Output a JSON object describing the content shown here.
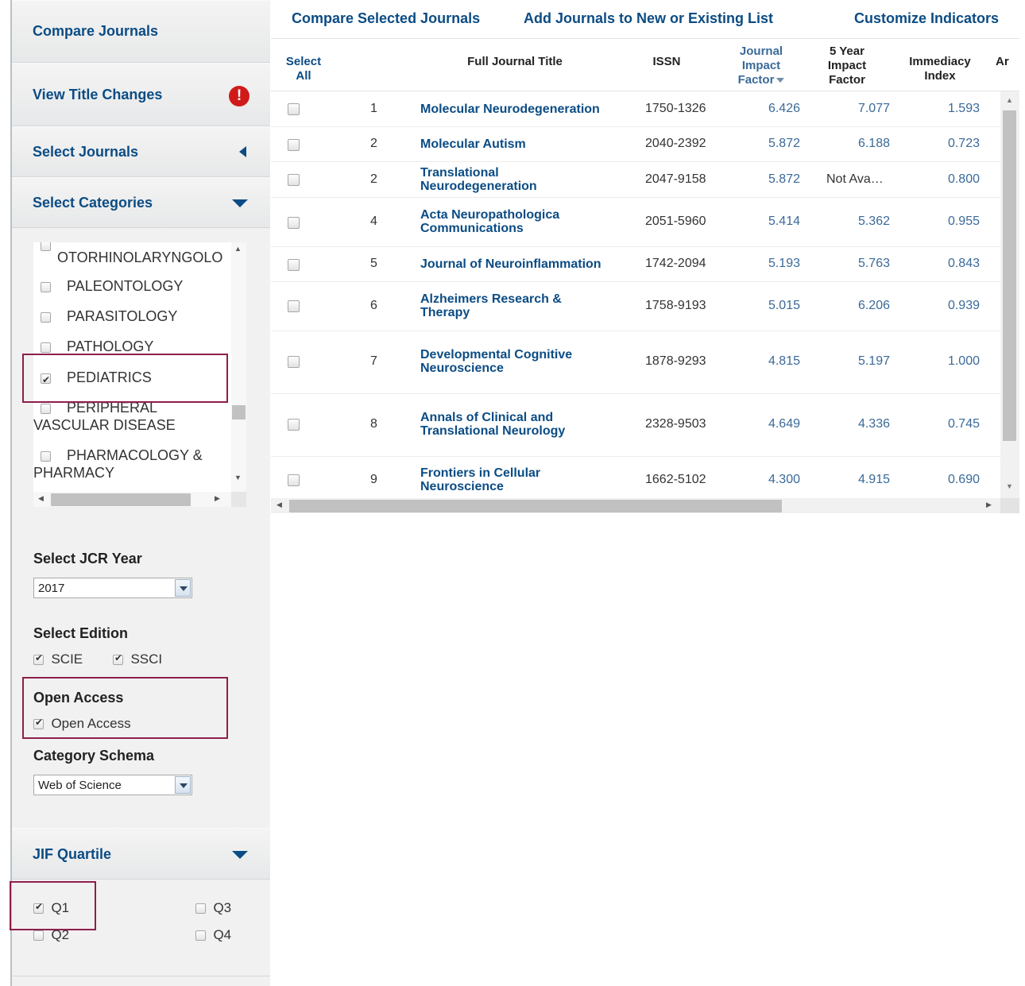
{
  "sidebar": {
    "compare_journals": "Compare Journals",
    "view_title_changes": "View Title Changes",
    "alert_glyph": "!",
    "select_journals": "Select Journals",
    "select_categories": "Select Categories",
    "categories": [
      {
        "label": "OTORHINOLARYNGOLO",
        "checked": false
      },
      {
        "label": "PALEONTOLOGY",
        "checked": false
      },
      {
        "label": "PARASITOLOGY",
        "checked": false
      },
      {
        "label": "PATHOLOGY",
        "checked": false
      },
      {
        "label": "PEDIATRICS",
        "checked": true
      },
      {
        "label": "PERIPHERAL",
        "label2": "VASCULAR DISEASE",
        "checked": false
      },
      {
        "label": "PHARMACOLOGY &",
        "label2": "PHARMACY",
        "checked": false
      }
    ],
    "jcr_year_title": "Select JCR Year",
    "jcr_year_value": "2017",
    "edition_title": "Select Edition",
    "editions": [
      {
        "label": "SCIE",
        "checked": true
      },
      {
        "label": "SSCI",
        "checked": true
      }
    ],
    "open_access_title": "Open Access",
    "open_access_label": "Open Access",
    "open_access_checked": true,
    "category_schema_title": "Category Schema",
    "category_schema_value": "Web of Science",
    "jif_quartile": "JIF Quartile",
    "quartiles": [
      {
        "label": "Q1",
        "checked": true
      },
      {
        "label": "Q3",
        "checked": false
      },
      {
        "label": "Q2",
        "checked": false
      },
      {
        "label": "Q4",
        "checked": false
      }
    ]
  },
  "toplinks": {
    "compare_selected": "Compare Selected Journals",
    "add_to_list": "Add Journals to New or Existing List",
    "customize": "Customize Indicators"
  },
  "table": {
    "headers": {
      "select_all": "Select All",
      "title": "Full Journal Title",
      "issn": "ISSN",
      "jif": "Journal Impact Factor",
      "five_year": "5 Year Impact Factor",
      "immediacy": "Immediacy Index",
      "next": "Ar"
    },
    "rows": [
      {
        "rank": "1",
        "title": "Molecular Neurodegeneration",
        "issn": "1750-1326",
        "jif": "6.426",
        "five_year": "7.077",
        "immediacy": "1.593"
      },
      {
        "rank": "2",
        "title": "Molecular Autism",
        "issn": "2040-2392",
        "jif": "5.872",
        "five_year": "6.188",
        "immediacy": "0.723"
      },
      {
        "rank": "2",
        "title": "Translational",
        "title2": "Neurodegeneration",
        "issn": "2047-9158",
        "jif": "5.872",
        "five_year": "Not Ava…",
        "immediacy": "0.800"
      },
      {
        "rank": "4",
        "title": "Acta Neuropathologica",
        "title2": "Communications",
        "issn": "2051-5960",
        "jif": "5.414",
        "five_year": "5.362",
        "immediacy": "0.955"
      },
      {
        "rank": "5",
        "title": "Journal of Neuroinflammation",
        "issn": "1742-2094",
        "jif": "5.193",
        "five_year": "5.763",
        "immediacy": "0.843"
      },
      {
        "rank": "6",
        "title": "Alzheimers Research &",
        "title2": "Therapy",
        "issn": "1758-9193",
        "jif": "5.015",
        "five_year": "6.206",
        "immediacy": "0.939"
      },
      {
        "rank": "7",
        "title": "Developmental Cognitive",
        "title2": "Neuroscience",
        "issn": "1878-9293",
        "jif": "4.815",
        "five_year": "5.197",
        "immediacy": "1.000"
      },
      {
        "rank": "8",
        "title": "Annals of Clinical and",
        "title2": "Translational Neurology",
        "issn": "2328-9503",
        "jif": "4.649",
        "five_year": "4.336",
        "immediacy": "0.745"
      },
      {
        "rank": "9",
        "title": "Frontiers in Cellular",
        "title2": "Neuroscience",
        "issn": "1662-5102",
        "jif": "4.300",
        "five_year": "4.915",
        "immediacy": "0.690"
      }
    ]
  },
  "colors": {
    "link_blue": "#0b4c84",
    "number_blue": "#3a6a99",
    "highlight_box": "#8e1f4b",
    "alert_red": "#d01a1a"
  }
}
